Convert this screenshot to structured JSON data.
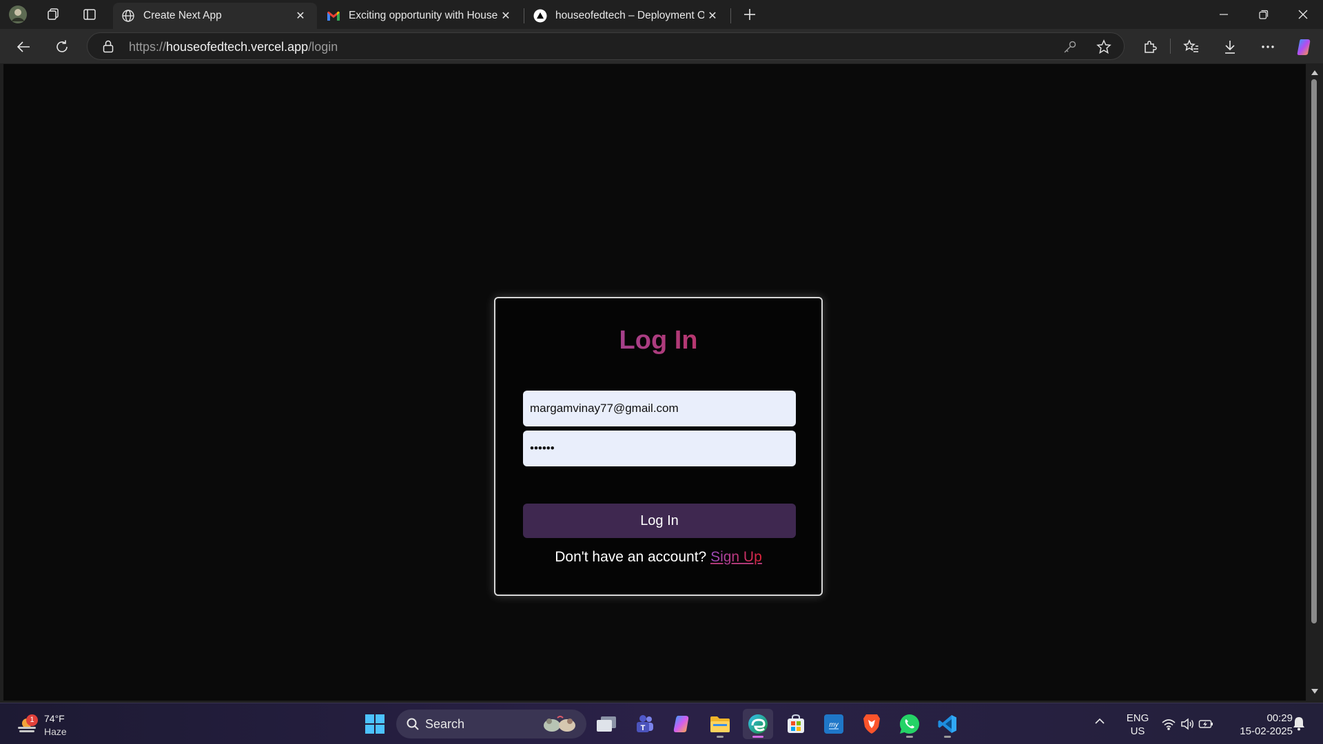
{
  "browser": {
    "tabs": [
      {
        "title": "Create Next App",
        "favicon": "globe-icon",
        "active": true
      },
      {
        "title": "Exciting opportunity with House c",
        "favicon": "gmail-icon",
        "active": false
      },
      {
        "title": "houseofedtech – Deployment Ov",
        "favicon": "vercel-icon",
        "active": false
      }
    ],
    "url": {
      "prefix": "https://",
      "host": "houseofedtech.vercel.app",
      "path": "/login"
    },
    "icons": [
      "profile-avatar-icon",
      "workspaces-icon",
      "vertical-tabs-icon",
      "new-tab-icon",
      "back-icon",
      "refresh-icon",
      "lock-icon",
      "key-icon",
      "favorite-star-icon",
      "extensions-icon",
      "favorites-icon",
      "downloads-icon",
      "more-icon",
      "copilot-icon"
    ]
  },
  "login": {
    "title": "Log In",
    "email_value": "margamvinay77@gmail.com",
    "password_value": "••••••",
    "submit_label": "Log In",
    "signup_prompt": "Don't have an account?",
    "signup_link": "Sign Up",
    "colors": {
      "gradient_start": "#8a4db8",
      "gradient_end": "#e0233a",
      "button": "#3f2850",
      "input_bg": "#e9eefb"
    }
  },
  "taskbar": {
    "weather": {
      "temp": "74°F",
      "condition": "Haze",
      "badge": "1"
    },
    "search_label": "Search",
    "apps": [
      "windows-start-icon",
      "task-view-icon",
      "teams-icon",
      "copilot-icon",
      "file-explorer-icon",
      "edge-icon",
      "store-icon",
      "myhp-icon",
      "brave-icon",
      "whatsapp-icon",
      "vscode-icon"
    ],
    "language": {
      "lang": "ENG",
      "region": "US"
    },
    "clock": {
      "time": "00:29",
      "date": "15-02-2025"
    }
  }
}
